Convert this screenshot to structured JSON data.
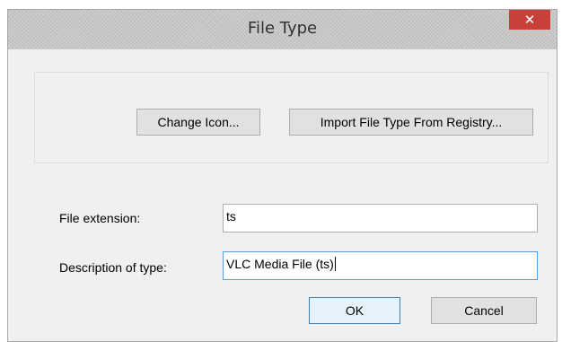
{
  "window": {
    "title": "File Type",
    "close_label": "✕"
  },
  "buttons": {
    "change_icon": "Change Icon...",
    "import_type": "Import File Type From Registry...",
    "ok": "OK",
    "cancel": "Cancel"
  },
  "fields": {
    "extension_label": "File extension:",
    "extension_value": "ts",
    "description_label": "Description of type:",
    "description_value": "VLC Media File (ts)"
  },
  "colors": {
    "close_button": "#c7413a",
    "dialog_background": "#f0f0f0",
    "focus_border": "#569de5"
  },
  "icons": {
    "close": "close-icon"
  }
}
